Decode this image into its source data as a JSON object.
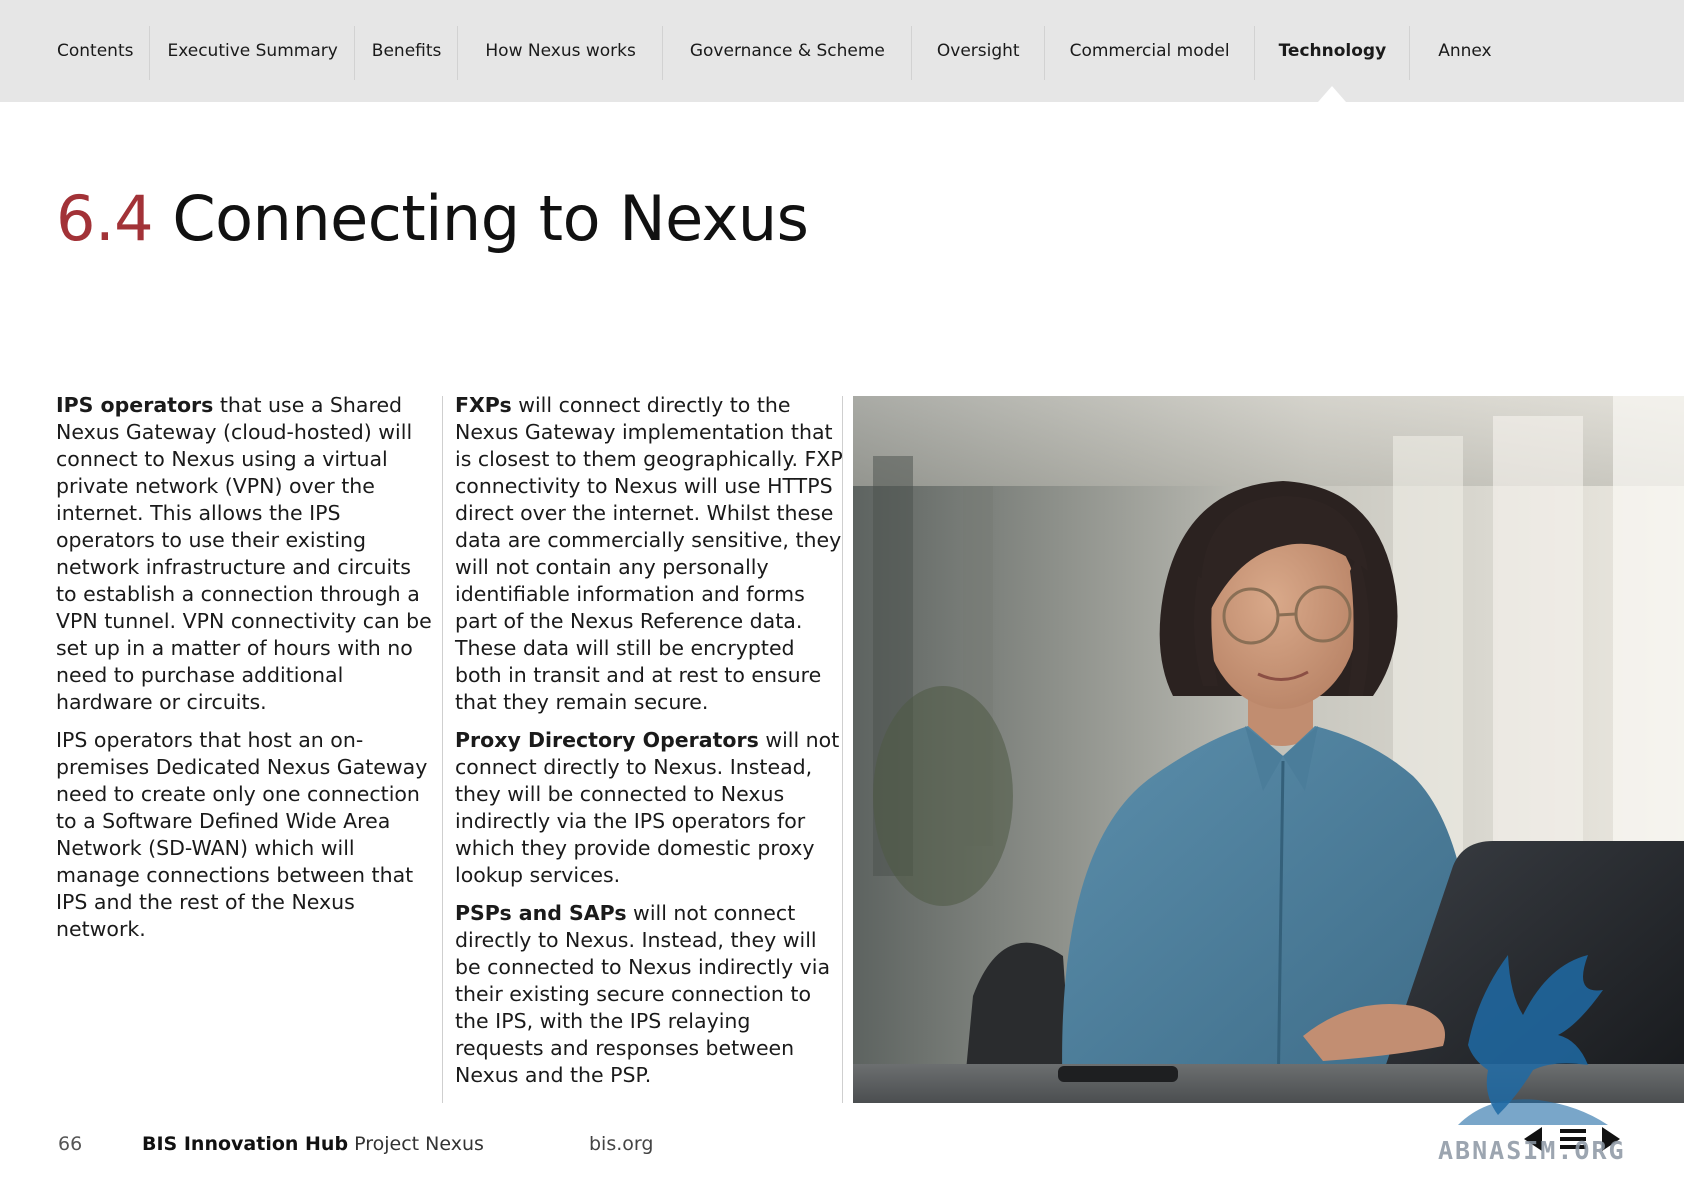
{
  "nav": {
    "items": [
      {
        "label": "Contents",
        "active": false
      },
      {
        "label": "Executive Summary",
        "active": false
      },
      {
        "label": "Benefits",
        "active": false
      },
      {
        "label": "How Nexus works",
        "active": false
      },
      {
        "label": "Governance & Scheme",
        "active": false
      },
      {
        "label": "Oversight",
        "active": false
      },
      {
        "label": "Commercial model",
        "active": false
      },
      {
        "label": "Technology",
        "active": true
      },
      {
        "label": "Annex",
        "active": false
      }
    ]
  },
  "title": {
    "number": "6.4",
    "text": "Connecting to Nexus"
  },
  "column1": {
    "p1_bold": "IPS operators",
    "p1_text": " that use a Shared Nexus Gateway (cloud-hosted) will connect to Nexus using a virtual private network (VPN) over the internet. This allows the IPS operators to use their existing network infrastructure and circuits to establish a connection through a VPN tunnel. VPN connectivity can be set up in a matter of hours with no need to purchase additional hardware or circuits.",
    "p2_text": "IPS operators that host an on-premises Dedicated Nexus Gateway need to create only one connection to a Software Defined Wide Area Network (SD-WAN) which will manage connections between that IPS and the rest of the Nexus network."
  },
  "column2": {
    "p1_bold": "FXPs",
    "p1_text": " will connect directly to the Nexus Gateway implementation that is closest to them geographically. FXP connectivity to Nexus will use HTTPS direct over the internet. Whilst these data are commercially sensitive, they will not contain any personally identifiable information and forms part of the Nexus Reference data. These data will still be encrypted both in transit and at rest to ensure that they remain secure.",
    "p2_bold": "Proxy Directory Operators",
    "p2_text": " will not connect directly to Nexus. Instead, they will be connected to Nexus indirectly via the IPS operators for which they provide domestic proxy lookup services.",
    "p3_bold": "PSPs and SAPs",
    "p3_text": " will not connect directly to Nexus. Instead, they will be connected to Nexus indirectly via their existing secure connection to the IPS, with the IPS relaying requests and responses between Nexus and the PSP."
  },
  "footer": {
    "page_number": "66",
    "brand_bold": "BIS Innovation Hub",
    "brand_text": " Project Nexus",
    "site": "bis.org"
  },
  "watermark": {
    "text": "ABNASIM.ORG"
  },
  "colors": {
    "accent_red": "#a23237",
    "nav_bg": "#e6e6e6",
    "shirt_blue": "#4f7f9c"
  }
}
